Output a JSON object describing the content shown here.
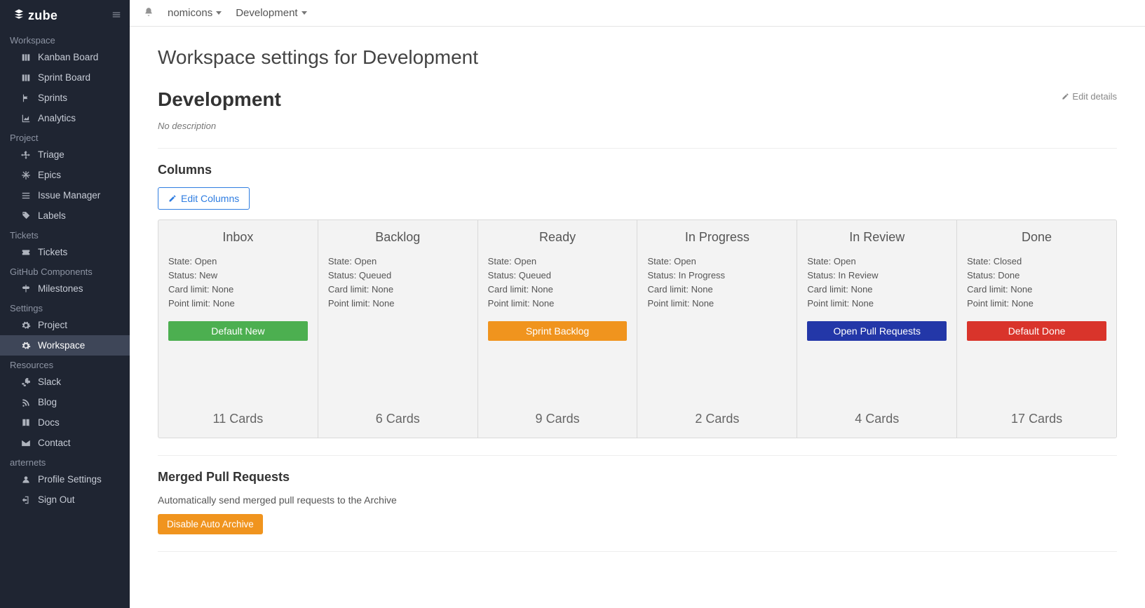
{
  "brand": "zube",
  "topbar": {
    "org": "nomicons",
    "workspace": "Development"
  },
  "sidebar": {
    "sections": [
      {
        "title": "Workspace",
        "items": [
          {
            "id": "kanban-board",
            "label": "Kanban Board",
            "icon": "columns"
          },
          {
            "id": "sprint-board",
            "label": "Sprint Board",
            "icon": "columns"
          },
          {
            "id": "sprints",
            "label": "Sprints",
            "icon": "flag"
          },
          {
            "id": "analytics",
            "label": "Analytics",
            "icon": "chart"
          }
        ]
      },
      {
        "title": "Project",
        "items": [
          {
            "id": "triage",
            "label": "Triage",
            "icon": "arrows"
          },
          {
            "id": "epics",
            "label": "Epics",
            "icon": "snow"
          },
          {
            "id": "issue-manager",
            "label": "Issue Manager",
            "icon": "list"
          },
          {
            "id": "labels",
            "label": "Labels",
            "icon": "tag"
          }
        ]
      },
      {
        "title": "Tickets",
        "items": [
          {
            "id": "tickets",
            "label": "Tickets",
            "icon": "ticket"
          }
        ]
      },
      {
        "title": "GitHub Components",
        "items": [
          {
            "id": "milestones",
            "label": "Milestones",
            "icon": "sign"
          }
        ]
      },
      {
        "title": "Settings",
        "items": [
          {
            "id": "project-settings",
            "label": "Project",
            "icon": "gear"
          },
          {
            "id": "workspace-settings",
            "label": "Workspace",
            "icon": "gear",
            "active": true
          }
        ]
      },
      {
        "title": "Resources",
        "items": [
          {
            "id": "slack",
            "label": "Slack",
            "icon": "slack"
          },
          {
            "id": "blog",
            "label": "Blog",
            "icon": "feed"
          },
          {
            "id": "docs",
            "label": "Docs",
            "icon": "book"
          },
          {
            "id": "contact",
            "label": "Contact",
            "icon": "mail"
          }
        ]
      },
      {
        "title": "arternets",
        "items": [
          {
            "id": "profile-settings",
            "label": "Profile Settings",
            "icon": "user"
          },
          {
            "id": "sign-out",
            "label": "Sign Out",
            "icon": "signout"
          }
        ]
      }
    ]
  },
  "page": {
    "title": "Workspace settings for Development",
    "workspace_name": "Development",
    "edit_details_label": "Edit details",
    "no_description": "No description",
    "columns_heading": "Columns",
    "edit_columns_label": "Edit Columns",
    "merged_pr_heading": "Merged Pull Requests",
    "merged_pr_subtext": "Automatically send merged pull requests to the Archive",
    "disable_auto_archive_label": "Disable Auto Archive"
  },
  "meta_labels": {
    "state": "State",
    "status": "Status",
    "card_limit": "Card limit",
    "point_limit": "Point limit"
  },
  "cards_suffix": "Cards",
  "columns": [
    {
      "name": "Inbox",
      "state": "Open",
      "status": "New",
      "card_limit": "None",
      "point_limit": "None",
      "badge": "Default New",
      "badge_color": "green",
      "cards": 11
    },
    {
      "name": "Backlog",
      "state": "Open",
      "status": "Queued",
      "card_limit": "None",
      "point_limit": "None",
      "badge": null,
      "cards": 6
    },
    {
      "name": "Ready",
      "state": "Open",
      "status": "Queued",
      "card_limit": "None",
      "point_limit": "None",
      "badge": "Sprint Backlog",
      "badge_color": "orange",
      "cards": 9
    },
    {
      "name": "In Progress",
      "state": "Open",
      "status": "In Progress",
      "card_limit": "None",
      "point_limit": "None",
      "badge": null,
      "cards": 2
    },
    {
      "name": "In Review",
      "state": "Open",
      "status": "In Review",
      "card_limit": "None",
      "point_limit": "None",
      "badge": "Open Pull Requests",
      "badge_color": "blue",
      "cards": 4
    },
    {
      "name": "Done",
      "state": "Closed",
      "status": "Done",
      "card_limit": "None",
      "point_limit": "None",
      "badge": "Default Done",
      "badge_color": "red",
      "cards": 17
    }
  ]
}
